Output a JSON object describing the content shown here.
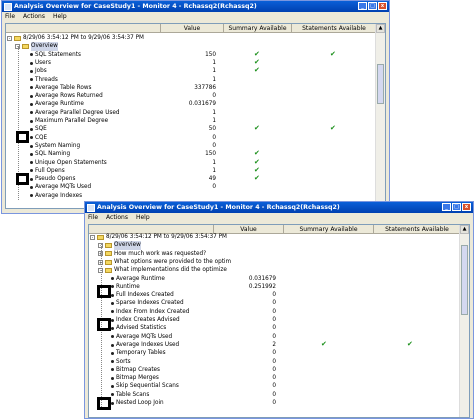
{
  "window1": {
    "title": "Analysis Overview for CaseStudy1 - Monitor 4 - Rchassq2(Rchassq2)",
    "menu": [
      "File",
      "Actions",
      "Help"
    ],
    "columns": {
      "value": "Value",
      "summary": "Summary Available",
      "statements": "Statements Available"
    },
    "root": "8/29/06 3:54:12 PM to 9/29/06 3:54:37 PM",
    "folder": "Overview",
    "rows": [
      {
        "label": "SQL Statements",
        "value": "150",
        "s": true,
        "st": true
      },
      {
        "label": "Users",
        "value": "1",
        "s": true,
        "st": false
      },
      {
        "label": "Jobs",
        "value": "1",
        "s": true,
        "st": false
      },
      {
        "label": "Threads",
        "value": "1",
        "s": false,
        "st": false
      },
      {
        "label": "Average Table Rows",
        "value": "337786",
        "s": false,
        "st": false
      },
      {
        "label": "Average Rows Returned",
        "value": "0",
        "s": false,
        "st": false
      },
      {
        "label": "Average Runtime",
        "value": "0.031679",
        "s": false,
        "st": false
      },
      {
        "label": "Average Parallel Degree Used",
        "value": "1",
        "s": false,
        "st": false
      },
      {
        "label": "Maximum Parallel Degree",
        "value": "1",
        "s": false,
        "st": false
      },
      {
        "label": "SQE",
        "value": "50",
        "s": true,
        "st": true
      },
      {
        "label": "CQE",
        "value": "0",
        "s": false,
        "st": false
      },
      {
        "label": "System Naming",
        "value": "0",
        "s": false,
        "st": false
      },
      {
        "label": "SQL Naming",
        "value": "150",
        "s": true,
        "st": false
      },
      {
        "label": "Unique Open Statements",
        "value": "1",
        "s": true,
        "st": false
      },
      {
        "label": "Full Opens",
        "value": "1",
        "s": true,
        "st": false
      },
      {
        "label": "Pseudo Opens",
        "value": "49",
        "s": true,
        "st": false
      },
      {
        "label": "Average MQTs Used",
        "value": "0",
        "s": false,
        "st": false
      },
      {
        "label": "Average Indexes",
        "value": "",
        "s": false,
        "st": false
      }
    ]
  },
  "window2": {
    "title": "Analysis Overview for CaseStudy1 - Monitor 4 - Rchassq2(Rchassq2)",
    "menu": [
      "File",
      "Actions",
      "Help"
    ],
    "columns": {
      "value": "Value",
      "summary": "Summary Available",
      "statements": "Statements Available"
    },
    "root": "8/29/06 3:54:12 PM to 9/29/06 3:54:37 PM",
    "rows": [
      {
        "type": "folder-open",
        "label": "Overview",
        "value": "",
        "s": false,
        "st": false,
        "indent": 1
      },
      {
        "type": "folder",
        "label": "How much work was requested?",
        "value": "",
        "s": false,
        "st": false,
        "indent": 1
      },
      {
        "type": "folder",
        "label": "What options were provided to the optim",
        "value": "",
        "s": false,
        "st": false,
        "indent": 1
      },
      {
        "type": "folder-open",
        "label": "What implementations did the optimize",
        "value": "",
        "s": false,
        "st": false,
        "indent": 1
      },
      {
        "type": "leaf",
        "label": "Average Runtime",
        "value": "0.031679",
        "s": false,
        "st": false,
        "indent": 2
      },
      {
        "type": "leaf",
        "label": "Runtime",
        "value": "0.251992",
        "s": false,
        "st": false,
        "indent": 2
      },
      {
        "type": "leaf",
        "label": "Full Indexes Created",
        "value": "0",
        "s": false,
        "st": false,
        "indent": 2
      },
      {
        "type": "leaf",
        "label": "Sparse Indexes Created",
        "value": "0",
        "s": false,
        "st": false,
        "indent": 2
      },
      {
        "type": "leaf",
        "label": "Index From Index Created",
        "value": "0",
        "s": false,
        "st": false,
        "indent": 2
      },
      {
        "type": "leaf",
        "label": "Index Creates Advised",
        "value": "0",
        "s": false,
        "st": false,
        "indent": 2
      },
      {
        "type": "leaf",
        "label": "Advised Statistics",
        "value": "0",
        "s": false,
        "st": false,
        "indent": 2
      },
      {
        "type": "leaf",
        "label": "Average MQTs Used",
        "value": "0",
        "s": false,
        "st": false,
        "indent": 2
      },
      {
        "type": "leaf",
        "label": "Average Indexes Used",
        "value": "2",
        "s": true,
        "st": true,
        "indent": 2
      },
      {
        "type": "leaf",
        "label": "Temporary Tables",
        "value": "0",
        "s": false,
        "st": false,
        "indent": 2
      },
      {
        "type": "leaf",
        "label": "Sorts",
        "value": "0",
        "s": false,
        "st": false,
        "indent": 2
      },
      {
        "type": "leaf",
        "label": "Bitmap Creates",
        "value": "0",
        "s": false,
        "st": false,
        "indent": 2
      },
      {
        "type": "leaf",
        "label": "Bitmap Merges",
        "value": "0",
        "s": false,
        "st": false,
        "indent": 2
      },
      {
        "type": "leaf",
        "label": "Skip Sequential Scans",
        "value": "0",
        "s": false,
        "st": false,
        "indent": 2
      },
      {
        "type": "leaf",
        "label": "Table Scans",
        "value": "0",
        "s": false,
        "st": false,
        "indent": 2
      },
      {
        "type": "leaf",
        "label": "Nested Loop Join",
        "value": "0",
        "s": false,
        "st": false,
        "indent": 2
      }
    ]
  },
  "checkmark": "✔",
  "colors": {
    "title": "#0a5fd8",
    "check": "#1a8f1a",
    "folder": "#f4d860"
  }
}
